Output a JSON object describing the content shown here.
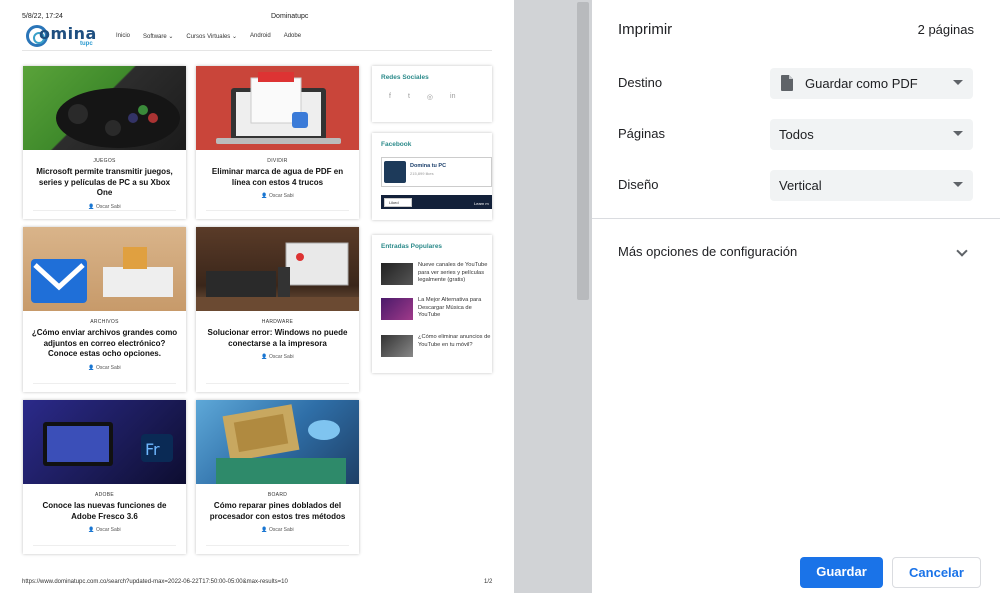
{
  "preview": {
    "header_datetime": "5/8/22, 17:24",
    "header_site": "Dominatupc",
    "footer_url": "https://www.dominatupc.com.co/search?updated-max=2022-06-22T17:50:00-05:00&max-results=10",
    "footer_page": "1/2",
    "logo_text": "omina",
    "logo_sub": "tupc",
    "nav": [
      "Inicio",
      "Software ⌄",
      "Cursos Virtuales ⌄",
      "Android",
      "Adobe"
    ],
    "articles": [
      {
        "category": "JUEGOS",
        "title": "Microsoft permite transmitir juegos, series y películas de PC a su Xbox One",
        "author": "Oscar Sabi"
      },
      {
        "category": "DIVIDIR",
        "title": "Eliminar marca de agua de PDF en línea con estos 4 trucos",
        "author": "Oscar Sabi"
      },
      {
        "category": "ARCHIVOS",
        "title": "¿Cómo enviar archivos grandes como adjuntos en correo electrónico? Conoce estas ocho opciones.",
        "author": "Oscar Sabi"
      },
      {
        "category": "HARDWARE",
        "title": "Solucionar error: Windows no puede conectarse a la impresora",
        "author": "Oscar Sabi"
      },
      {
        "category": "ADOBE",
        "title": "Conoce las nuevas funciones de Adobe Fresco 3.6",
        "author": "Oscar Sabi"
      },
      {
        "category": "BOARD",
        "title": "Cómo reparar pines doblados del procesador con estos tres métodos",
        "author": "Oscar Sabi"
      }
    ],
    "sidebar": {
      "social_title": "Redes Sociales",
      "social_icons": [
        "f",
        "t",
        "◎",
        "in"
      ],
      "facebook_title": "Facebook",
      "fb_page_name": "Domina tu PC",
      "fb_likes": "215,899 likes",
      "fb_liked": "Liked",
      "fb_learn": "Learn m",
      "popular_title": "Entradas Populares",
      "popular": [
        "Nueve canales de YouTube para ver series y películas legalmente (gratis)",
        "La Mejor Alternativa para Descargar Música de YouTube",
        "¿Cómo eliminar anuncios de YouTube en tu móvil?"
      ]
    }
  },
  "panel": {
    "title": "Imprimir",
    "pages_count": "2 páginas",
    "destination_label": "Destino",
    "destination_value": "Guardar como PDF",
    "pages_label": "Páginas",
    "pages_value": "Todos",
    "layout_label": "Diseño",
    "layout_value": "Vertical",
    "more_options": "Más opciones de configuración",
    "save_button": "Guardar",
    "cancel_button": "Cancelar"
  },
  "colors": {
    "accent": "#1a73e8",
    "select_bg": "#f1f3f4",
    "preview_bg": "#d1d3d6",
    "widget_title": "#2b8a8a"
  }
}
